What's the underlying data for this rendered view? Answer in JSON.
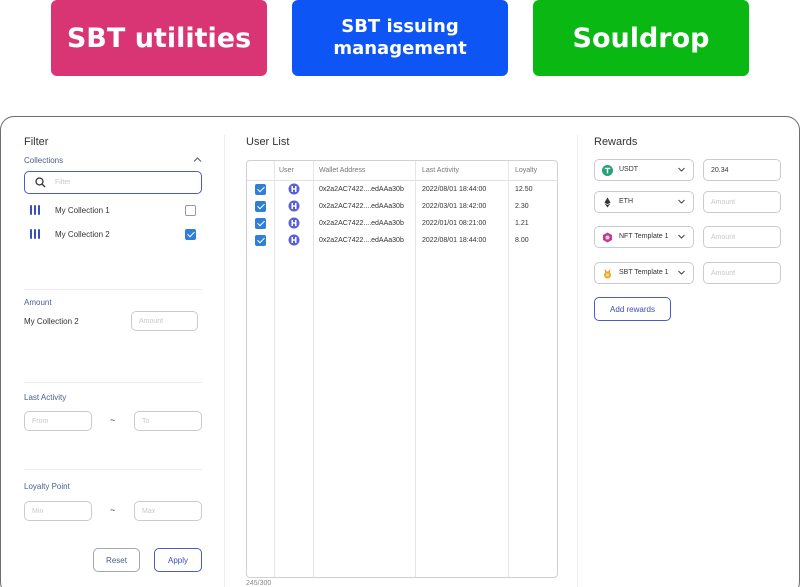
{
  "badges": {
    "utilities": "SBT utilities",
    "issuing_line1": "SBT issuing",
    "issuing_line2": "management",
    "souldrop": "Souldrop"
  },
  "filter": {
    "title": "Filter",
    "collections_label": "Collections",
    "search_placeholder": "Filter",
    "collections": [
      {
        "name": "My Collection 1",
        "checked": false
      },
      {
        "name": "My Collection 2",
        "checked": true
      }
    ],
    "amount_label": "Amount",
    "amount_collection": "My Collection 2",
    "amount_placeholder": "Amount",
    "last_activity_label": "Last Activity",
    "from_placeholder": "From",
    "to_placeholder": "To",
    "range_sep": "~",
    "loyalty_label": "Loyalty Point",
    "min_placeholder": "Min",
    "max_placeholder": "Max",
    "reset_label": "Reset",
    "apply_label": "Apply"
  },
  "user_list": {
    "title": "User List",
    "columns": [
      "User",
      "Wallet Address",
      "Last Activity",
      "Loyalty"
    ],
    "rows": [
      {
        "wallet": "0x2a2AC7422....edAAa30b",
        "last_activity": "2022/08/01 18:44:00",
        "loyalty": "12.50",
        "checked": true
      },
      {
        "wallet": "0x2a2AC7422....edAAa30b",
        "last_activity": "2022/03/01 18:42:00",
        "loyalty": "2.30",
        "checked": true
      },
      {
        "wallet": "0x2a2AC7422....edAAa30b",
        "last_activity": "2022/01/01 08:21:00",
        "loyalty": "1.21",
        "checked": true
      },
      {
        "wallet": "0x2a2AC7422....edAAa30b",
        "last_activity": "2022/08/01 18:44:00",
        "loyalty": "8.00",
        "checked": true
      }
    ],
    "count": "245/300"
  },
  "rewards": {
    "title": "Rewards",
    "items": [
      {
        "token": "USDT",
        "icon": "tether-icon",
        "amount": "20.34",
        "placeholder": ""
      },
      {
        "token": "ETH",
        "icon": "ethereum-icon",
        "amount": "",
        "placeholder": "Amount"
      },
      {
        "token": "NFT Template 1",
        "icon": "nft-icon",
        "amount": "",
        "placeholder": "Amount"
      },
      {
        "token": "SBT Template 1",
        "icon": "sbt-medal-icon",
        "amount": "",
        "placeholder": "Amount"
      }
    ],
    "add_label": "Add rewards"
  },
  "colors": {
    "utilities": "#d93574",
    "issuing": "#0d55f5",
    "souldrop": "#09b813",
    "accent": "#4a5cc8",
    "checkbox": "#2f7ed8"
  }
}
